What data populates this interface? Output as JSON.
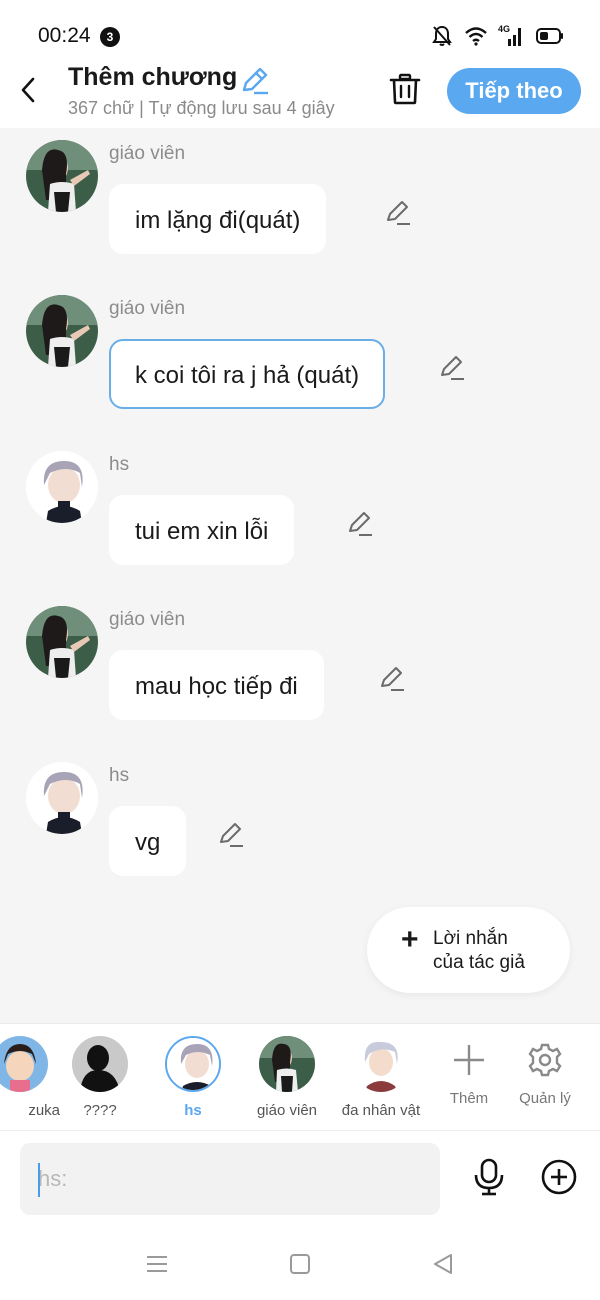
{
  "status_bar": {
    "time": "00:24",
    "notification_count": "3",
    "network_label": "4G"
  },
  "header": {
    "title": "Thêm chương",
    "subtitle": "367 chữ | Tự động lưu sau 4 giây",
    "next_label": "Tiếp theo"
  },
  "messages": [
    {
      "sender": "giáo viên",
      "text": "im lặng đi(quát)",
      "avatar": "teacher-avatar"
    },
    {
      "sender": "giáo viên",
      "text": "k coi tôi ra j hả (quát)",
      "avatar": "teacher-avatar",
      "selected": true
    },
    {
      "sender": "hs",
      "text": "tui em xin lỗi",
      "avatar": "student-avatar"
    },
    {
      "sender": "giáo viên",
      "text": "mau học tiếp đi",
      "avatar": "teacher-avatar"
    },
    {
      "sender": "hs",
      "text": "vg",
      "avatar": "student-avatar"
    }
  ],
  "author_note": {
    "line1": "Lời nhắn",
    "line2": "của tác giả"
  },
  "characters": [
    {
      "label": "zuka",
      "avatar": "shizuka-avatar"
    },
    {
      "label": "????",
      "avatar": "silhouette-avatar"
    },
    {
      "label": "hs",
      "avatar": "student-avatar",
      "active": true
    },
    {
      "label": "giáo viên",
      "avatar": "teacher-avatar"
    },
    {
      "label": "đa nhân vật",
      "avatar": "multi-character-avatar"
    }
  ],
  "char_tools": {
    "add_label": "Thêm",
    "manage_label": "Quản lý"
  },
  "input": {
    "placeholder": "hs:",
    "value": ""
  },
  "colors": {
    "accent": "#5aa8ef",
    "background": "#f5f5f5",
    "bubble": "#ffffff",
    "selected_border": "#6aaee8"
  }
}
